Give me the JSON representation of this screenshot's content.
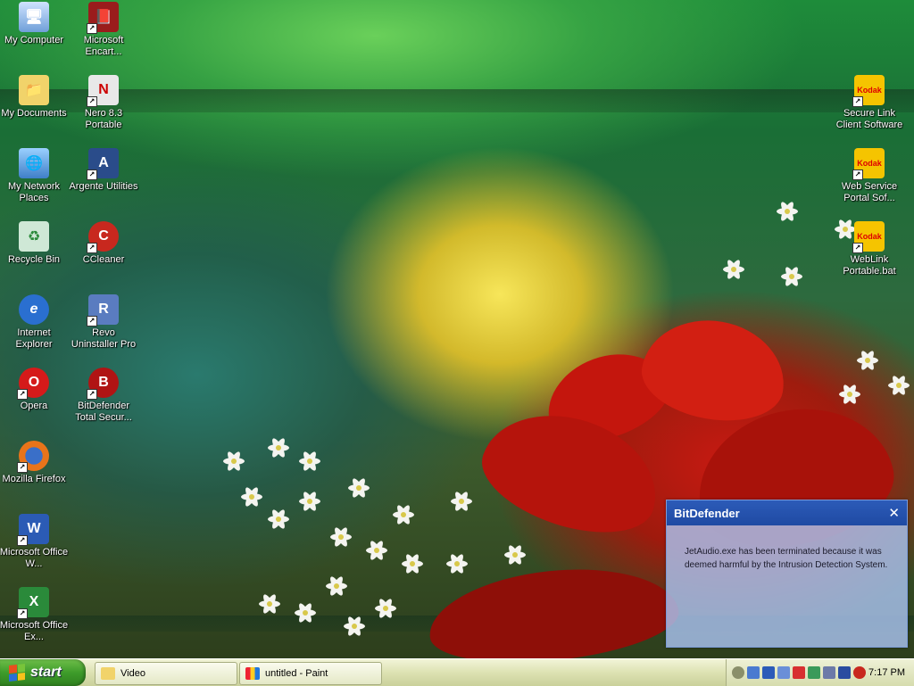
{
  "desktop_icons_left": [
    {
      "label": "My Computer",
      "icon": "my-computer-icon"
    },
    {
      "label": "Microsoft Encart...",
      "icon": "encarta-icon"
    },
    {
      "label": "My Documents",
      "icon": "my-documents-icon"
    },
    {
      "label": "Nero 8.3 Portable",
      "icon": "nero-icon"
    },
    {
      "label": "My Network Places",
      "icon": "network-places-icon"
    },
    {
      "label": "Argente Utilities",
      "icon": "argente-icon"
    },
    {
      "label": "Recycle Bin",
      "icon": "recycle-bin-icon"
    },
    {
      "label": "CCleaner",
      "icon": "ccleaner-icon"
    },
    {
      "label": "Internet Explorer",
      "icon": "internet-explorer-icon"
    },
    {
      "label": "Revo Uninstaller Pro",
      "icon": "revo-icon"
    },
    {
      "label": "Opera",
      "icon": "opera-icon"
    },
    {
      "label": "BitDefender Total Secur...",
      "icon": "bitdefender-icon"
    },
    {
      "label": "Mozilla Firefox",
      "icon": "firefox-icon"
    },
    {
      "label": "Microsoft Office W...",
      "icon": "word-icon"
    },
    {
      "label": "Microsoft Office Ex...",
      "icon": "excel-icon"
    }
  ],
  "desktop_icons_right": [
    {
      "label": "Secure Link Client Software",
      "icon": "kodak-icon"
    },
    {
      "label": "Web Service Portal Sof...",
      "icon": "kodak-icon"
    },
    {
      "label": "WebLink Portable.bat",
      "icon": "kodak-icon"
    }
  ],
  "popup": {
    "title": "BitDefender",
    "close": "✕",
    "message": "JetAudio.exe has been terminated because it was deemed harmful by the Intrusion Detection System."
  },
  "taskbar": {
    "start_label": "start",
    "tasks": [
      {
        "label": "Video",
        "icon": "folder-icon"
      },
      {
        "label": "untitled - Paint",
        "icon": "paint-icon"
      }
    ],
    "clock": "7:17 PM"
  },
  "colors": {
    "popup_header": "#2c5bb8",
    "start_green": "#3e9c2a",
    "taskbar": "#dde2b2"
  }
}
